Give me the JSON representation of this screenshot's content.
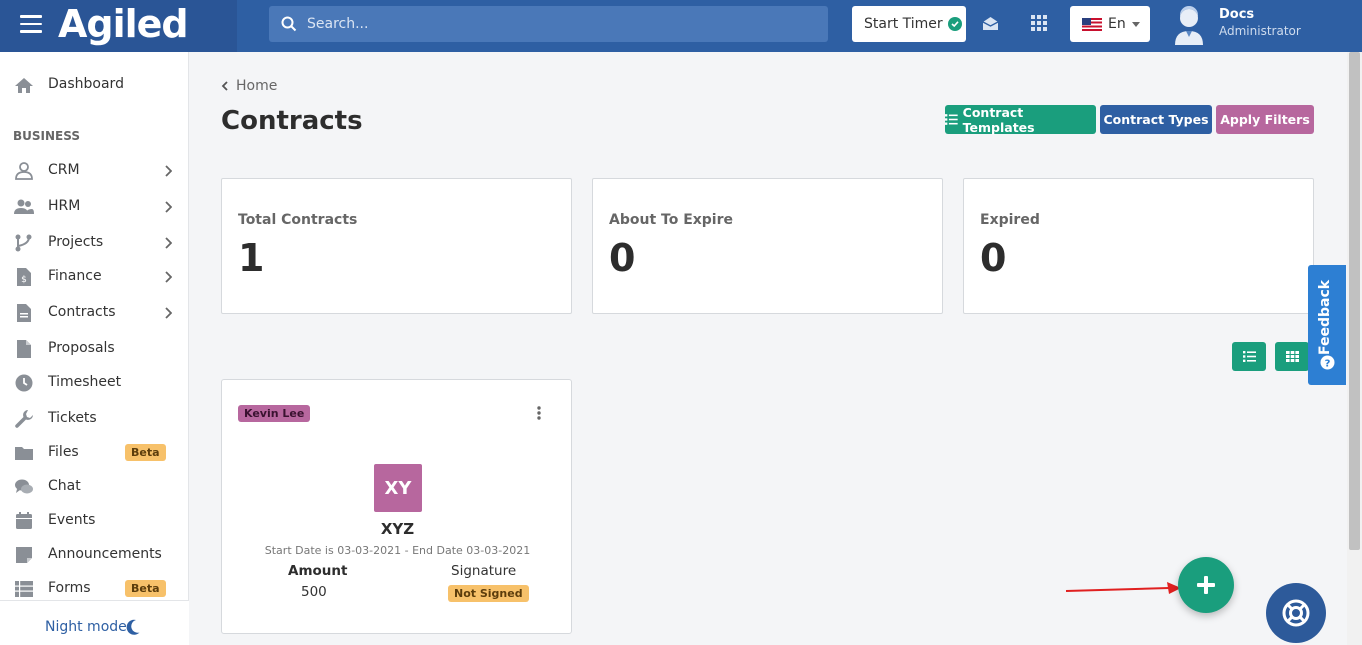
{
  "header": {
    "logo": "Agiled",
    "search_placeholder": "Search...",
    "start_timer": "Start Timer",
    "language": "En",
    "user_name": "Docs",
    "user_role": "Administrator"
  },
  "sidebar": {
    "dashboard": "Dashboard",
    "section_business": "BUSINESS",
    "items": [
      {
        "label": "CRM",
        "icon": "user-icon",
        "has_chevron": true
      },
      {
        "label": "HRM",
        "icon": "users-icon",
        "has_chevron": true
      },
      {
        "label": "Projects",
        "icon": "branch-icon",
        "has_chevron": true
      },
      {
        "label": "Finance",
        "icon": "dollar-file-icon",
        "has_chevron": true
      },
      {
        "label": "Contracts",
        "icon": "contract-icon",
        "has_chevron": true
      },
      {
        "label": "Proposals",
        "icon": "file-icon",
        "has_chevron": false
      },
      {
        "label": "Timesheet",
        "icon": "clock-icon",
        "has_chevron": false
      },
      {
        "label": "Tickets",
        "icon": "wrench-icon",
        "has_chevron": false
      },
      {
        "label": "Files",
        "icon": "folder-icon",
        "has_chevron": false,
        "badge": "Beta"
      },
      {
        "label": "Chat",
        "icon": "comments-icon",
        "has_chevron": false
      },
      {
        "label": "Events",
        "icon": "calendar-icon",
        "has_chevron": false
      },
      {
        "label": "Announcements",
        "icon": "sticky-note-icon",
        "has_chevron": false
      },
      {
        "label": "Forms",
        "icon": "list-icon",
        "has_chevron": false,
        "badge": "Beta"
      }
    ],
    "night_mode": "Night mode"
  },
  "main": {
    "breadcrumb": "Home",
    "title": "Contracts",
    "buttons": {
      "templates": "Contract Templates",
      "types": "Contract Types",
      "filters": "Apply Filters"
    },
    "stats": [
      {
        "title": "Total Contracts",
        "value": "1"
      },
      {
        "title": "About To Expire",
        "value": "0"
      },
      {
        "title": "Expired",
        "value": "0"
      }
    ],
    "contract": {
      "client_tag": "Kevin Lee",
      "initials": "XY",
      "name": "XYZ",
      "dates": "Start Date is 03-03-2021 - End Date 03-03-2021",
      "amount_label": "Amount",
      "amount": "500",
      "signature_label": "Signature",
      "signature_status": "Not Signed"
    }
  },
  "feedback": "Feedback",
  "colors": {
    "header": "#2e5fa3",
    "primary_green": "#1a9e7d",
    "blue_button": "#2e5fa3",
    "purple": "#b7679e",
    "warning": "#f7c16a"
  }
}
